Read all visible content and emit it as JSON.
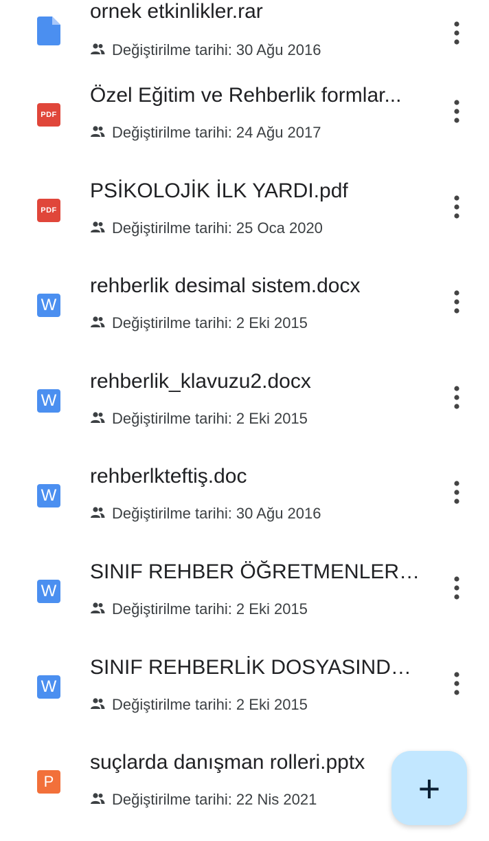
{
  "files": [
    {
      "name": "ornek etkinlikler.rar",
      "meta": "Değiştirilme tarihi: 30 Ağu 2016",
      "icon": "doc-icon",
      "icon_label": ""
    },
    {
      "name": "Özel Eğitim ve Rehberlik formlar...",
      "meta": "Değiştirilme tarihi: 24 Ağu 2017",
      "icon": "pdf-icon",
      "icon_label": "PDF"
    },
    {
      "name": "PSİKOLOJİK İLK YARDI.pdf",
      "meta": "Değiştirilme tarihi: 25 Oca 2020",
      "icon": "pdf-icon",
      "icon_label": "PDF"
    },
    {
      "name": "rehberlik desimal sistem.docx",
      "meta": "Değiştirilme tarihi: 2 Eki 2015",
      "icon": "word-icon",
      "icon_label": "W"
    },
    {
      "name": "rehberlik_klavuzu2.docx",
      "meta": "Değiştirilme tarihi: 2 Eki 2015",
      "icon": "word-icon",
      "icon_label": "W"
    },
    {
      "name": "rehberlkteftiş.doc",
      "meta": "Değiştirilme tarihi: 30 Ağu 2016",
      "icon": "word-icon",
      "icon_label": "W"
    },
    {
      "name": "SINIF REHBER ÖĞRETMENLERİ...",
      "meta": "Değiştirilme tarihi: 2 Eki 2015",
      "icon": "word-icon",
      "icon_label": "W"
    },
    {
      "name": "SINIF REHBERLİK DOSYASINDA ...",
      "meta": "Değiştirilme tarihi: 2 Eki 2015",
      "icon": "word-icon",
      "icon_label": "W"
    },
    {
      "name": "suçlarda danışman rolleri.pptx",
      "meta": "Değiştirilme tarihi: 22 Nis 2021",
      "icon": "powerpoint-icon",
      "icon_label": "P"
    }
  ],
  "fab": {
    "label": "+",
    "icon": "plus-icon"
  },
  "colors": {
    "pdf": "#e0463a",
    "word": "#4b8ff0",
    "doc": "#4b8ff0",
    "ppt": "#f2703a",
    "fab_bg": "#c2e7ff"
  }
}
